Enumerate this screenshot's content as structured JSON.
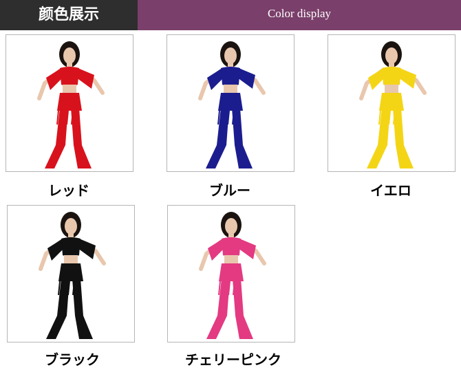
{
  "header": {
    "title_jp": "颜色展示",
    "title_en": "Color display"
  },
  "colors": [
    {
      "label": "レッド",
      "top": "#d8121c",
      "pants": "#d8121c",
      "skin": "#e9c7ad",
      "hair": "#1a1310"
    },
    {
      "label": "ブルー",
      "top": "#1b1d8f",
      "pants": "#1b1d8f",
      "skin": "#e9c7ad",
      "hair": "#1a1310"
    },
    {
      "label": "イエロ",
      "top": "#f4d515",
      "pants": "#f4d515",
      "skin": "#e9c7ad",
      "hair": "#1a1310"
    },
    {
      "label": "ブラック",
      "top": "#111111",
      "pants": "#111111",
      "skin": "#e9c7ad",
      "hair": "#1a1310"
    },
    {
      "label": "チェリーピンク",
      "top": "#e33a82",
      "pants": "#e33a82",
      "skin": "#e9c7ad",
      "hair": "#1a1310"
    }
  ]
}
